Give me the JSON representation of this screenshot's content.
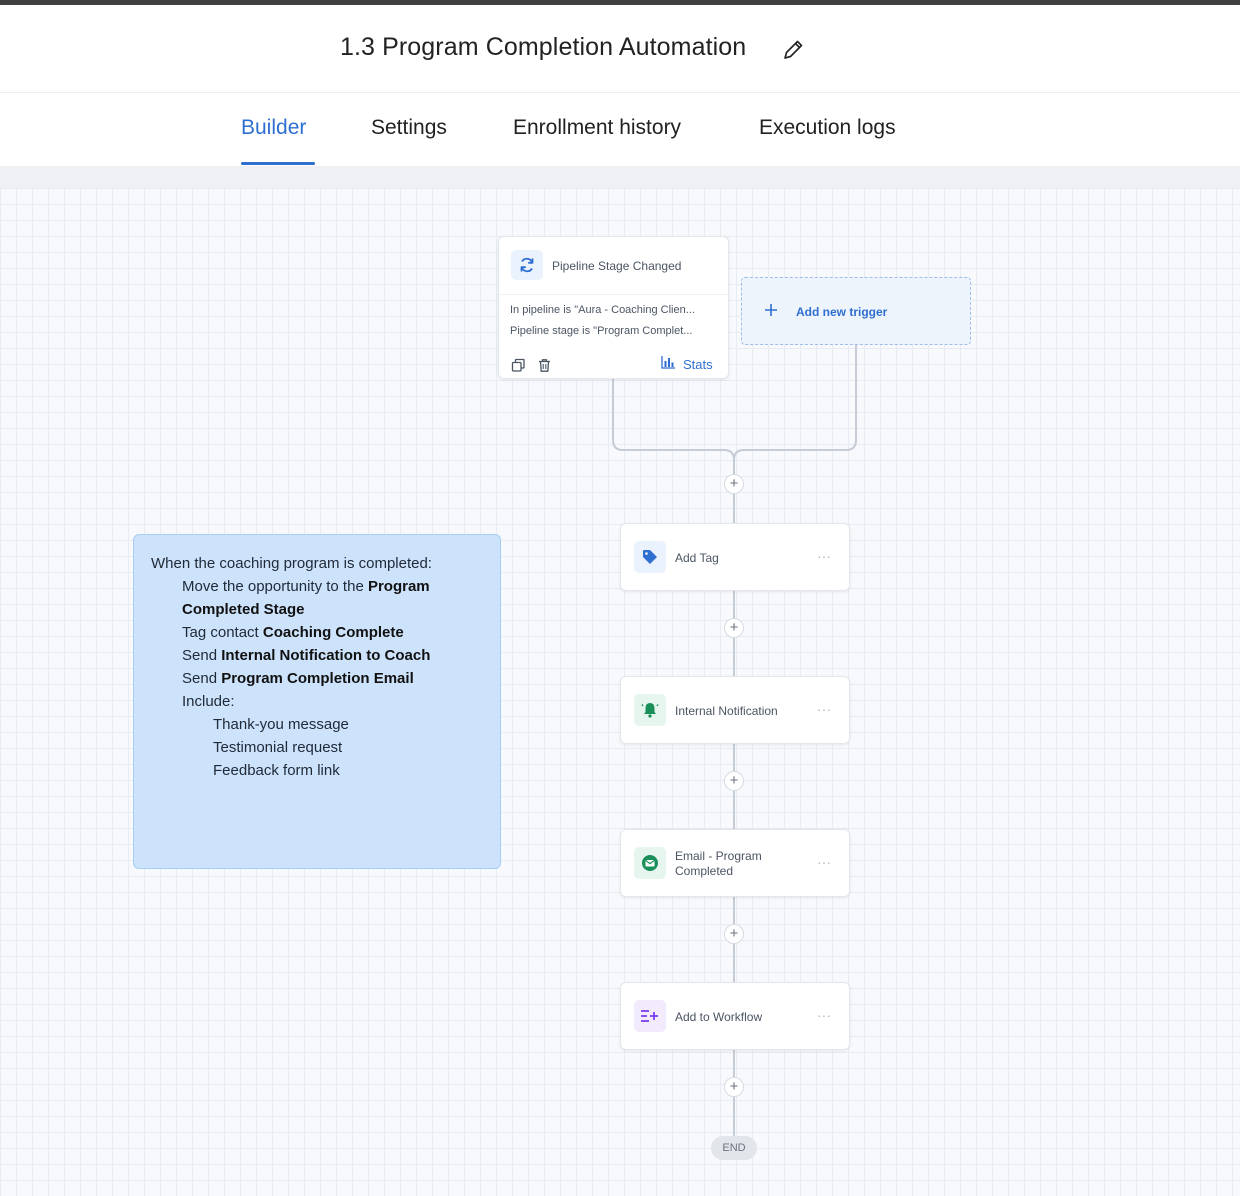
{
  "header": {
    "title": "1.3 Program Completion Automation",
    "edit_icon": "pencil-icon"
  },
  "tabs": [
    {
      "label": "Builder",
      "active": true
    },
    {
      "label": "Settings",
      "active": false
    },
    {
      "label": "Enrollment history",
      "active": false
    },
    {
      "label": "Execution logs",
      "active": false
    }
  ],
  "trigger": {
    "icon": "refresh-icon",
    "name": "Pipeline Stage Changed",
    "conditions": [
      "In pipeline is \"Aura - Coaching Clien...",
      "Pipeline stage is \"Program Complet..."
    ],
    "stats_label": "Stats",
    "footer_icons": [
      "copy-icon",
      "trash-icon",
      "bar-chart-icon"
    ]
  },
  "add_trigger": {
    "label": "Add new trigger",
    "icon": "plus-icon"
  },
  "actions": [
    {
      "label": "Add Tag",
      "icon": "tag-icon",
      "color": "#2f6fd1"
    },
    {
      "label": "Internal Notification",
      "icon": "bell-icon",
      "color": "#1a8f5a"
    },
    {
      "label_line1": "Email - Program",
      "label_line2": "Completed",
      "icon": "email-icon",
      "color": "#1a8f5a"
    },
    {
      "label": "Add to Workflow",
      "icon": "workflow-icon",
      "color": "#7c3aed"
    }
  ],
  "more_label": "···",
  "plus_label": "+",
  "end_label": "END",
  "note": {
    "intro": "When the coaching program is completed:",
    "l1_pre": "Move the opportunity to the ",
    "l1_bold": "Program",
    "l2_bold": "Completed Stage",
    "l3_pre": "Tag contact ",
    "l3_bold": "Coaching Complete",
    "l4_pre": "Send ",
    "l4_bold": "Internal Notification to Coach",
    "l5_pre": "Send ",
    "l5_bold": "Program Completion Email",
    "l6": "Include:",
    "sub": [
      "Thank-you message",
      "Testimonial request",
      "Feedback form link"
    ]
  },
  "colors": {
    "accent": "#2f6fd1",
    "note_bg": "#cde3fb"
  }
}
